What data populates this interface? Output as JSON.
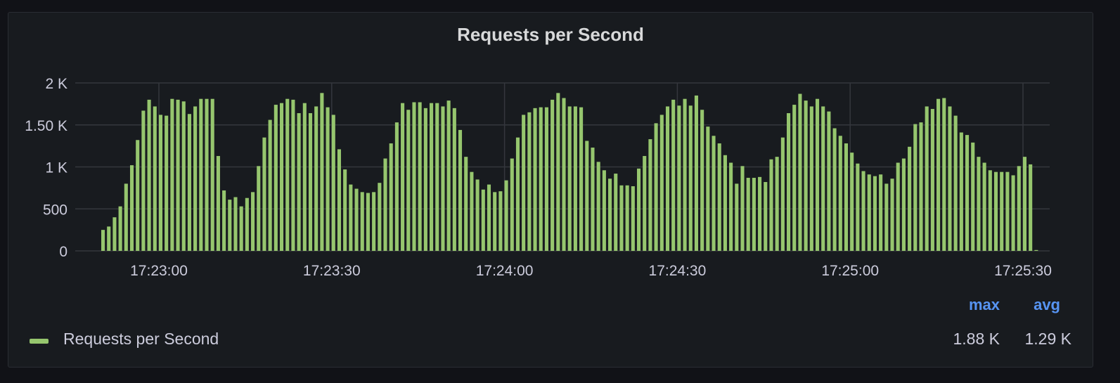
{
  "panel": {
    "title": "Requests per Second"
  },
  "legend": {
    "headers": {
      "max": "max",
      "avg": "avg"
    },
    "series_name": "Requests per Second",
    "max": "1.88 K",
    "avg": "1.29 K"
  },
  "colors": {
    "bar": "#96c66e",
    "background": "#181b1f",
    "grid": "#34373d",
    "text": "#ccccdc",
    "accent": "#5794f2"
  },
  "chart_data": {
    "type": "bar",
    "title": "Requests per Second",
    "xlabel": "",
    "ylabel": "",
    "ylim": [
      0,
      2000
    ],
    "y_ticks": [
      {
        "value": 0,
        "label": "0"
      },
      {
        "value": 500,
        "label": "500"
      },
      {
        "value": 1000,
        "label": "1 K"
      },
      {
        "value": 1500,
        "label": "1.50 K"
      },
      {
        "value": 2000,
        "label": "2 K"
      }
    ],
    "x_ticks": [
      {
        "t": 0,
        "label": "17:23:00"
      },
      {
        "t": 30,
        "label": "17:23:30"
      },
      {
        "t": 60,
        "label": "17:24:00"
      },
      {
        "t": 90,
        "label": "17:24:30"
      },
      {
        "t": 120,
        "label": "17:25:00"
      },
      {
        "t": 150,
        "label": "17:25:30"
      }
    ],
    "x_start_seconds_after_17_22_50": 0,
    "grid": true,
    "legend_position": "bottom",
    "series": [
      {
        "name": "Requests per Second",
        "values": [
          250,
          290,
          400,
          530,
          800,
          1020,
          1320,
          1670,
          1800,
          1720,
          1620,
          1610,
          1810,
          1800,
          1780,
          1630,
          1720,
          1810,
          1810,
          1810,
          1130,
          720,
          610,
          640,
          530,
          630,
          700,
          1010,
          1350,
          1560,
          1740,
          1760,
          1810,
          1800,
          1640,
          1760,
          1640,
          1720,
          1880,
          1710,
          1620,
          1210,
          970,
          790,
          740,
          700,
          690,
          700,
          810,
          1100,
          1280,
          1530,
          1760,
          1680,
          1770,
          1770,
          1700,
          1760,
          1760,
          1720,
          1790,
          1700,
          1440,
          1120,
          940,
          850,
          730,
          790,
          700,
          710,
          840,
          1100,
          1350,
          1620,
          1650,
          1700,
          1710,
          1710,
          1800,
          1880,
          1820,
          1720,
          1720,
          1710,
          1310,
          1230,
          1060,
          960,
          860,
          920,
          780,
          780,
          770,
          980,
          1130,
          1330,
          1520,
          1620,
          1720,
          1800,
          1730,
          1810,
          1730,
          1850,
          1680,
          1480,
          1370,
          1280,
          1140,
          1050,
          800,
          1010,
          870,
          870,
          880,
          820,
          1090,
          1120,
          1350,
          1640,
          1740,
          1870,
          1790,
          1720,
          1810,
          1720,
          1660,
          1460,
          1370,
          1280,
          1170,
          1040,
          950,
          910,
          890,
          910,
          800,
          860,
          1050,
          1100,
          1240,
          1510,
          1530,
          1720,
          1690,
          1810,
          1820,
          1720,
          1610,
          1410,
          1380,
          1290,
          1120,
          1050,
          960,
          940,
          940,
          940,
          900,
          1010,
          1120,
          1030,
          10
        ]
      }
    ]
  }
}
